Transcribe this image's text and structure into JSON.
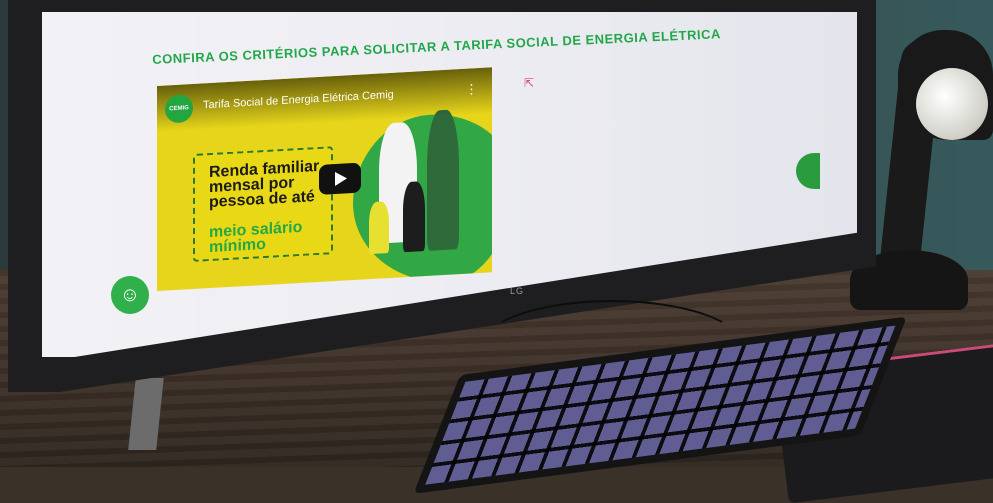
{
  "page": {
    "heading": "CONFIRA OS CRITÉRIOS PARA SOLICITAR A TARIFA SOCIAL DE ENERGIA ELÉTRICA"
  },
  "video": {
    "channel_logo_text": "CEMIG",
    "title": "Tarifa Social de Energia Elétrica Cemig",
    "card_text": "Renda familiar mensal por pessoa de até",
    "card_highlight": "meio salário mínimo"
  },
  "monitor": {
    "brand": "LG"
  },
  "colors": {
    "accent_green": "#22a84a",
    "video_yellow": "#e6d51a"
  }
}
